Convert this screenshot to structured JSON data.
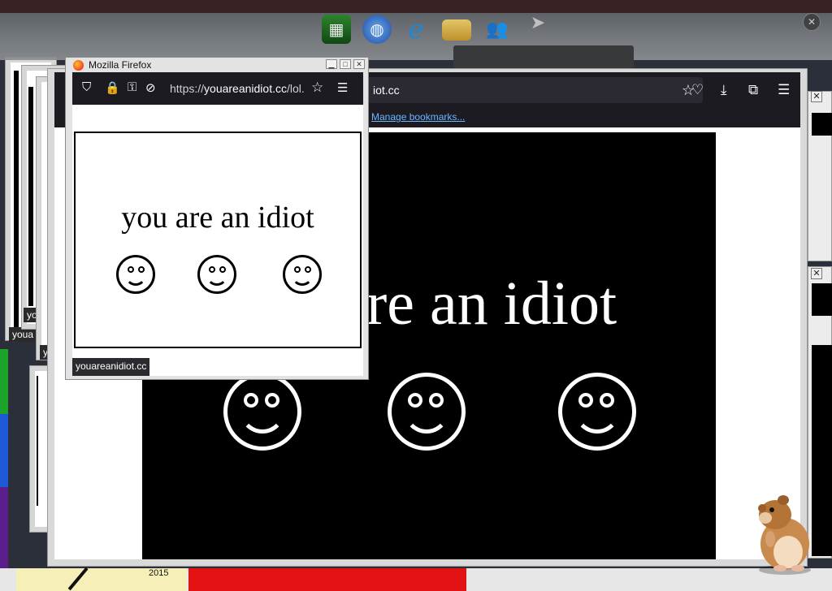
{
  "colors": {
    "taskbar": "#6b6f73",
    "stage": "#000000",
    "link": "#6bb6ff",
    "firefox_toolbar": "#1c1b22"
  },
  "taskbar": {
    "icons": [
      "spreadsheet-icon",
      "globe-icon",
      "internet-explorer-icon",
      "folder-icon",
      "people-icon",
      "cursor-icon"
    ],
    "close_icon": "close-icon"
  },
  "background_windows": {
    "labels": [
      "youa",
      "yo",
      "y"
    ],
    "year_text": "2015"
  },
  "big_window": {
    "url_text": "iot.cc",
    "bookmark_link": "Manage bookmarks...",
    "page_text": "re an idiot",
    "smiley_count": 3
  },
  "popup": {
    "title": "Mozilla Firefox",
    "url_prefix": "https://",
    "url_domain": "youareanidiot.cc",
    "url_suffix": "/lol.",
    "page_text": "you are an idiot",
    "status_text": "youareanidiot.cc",
    "smiley_count": 3
  }
}
